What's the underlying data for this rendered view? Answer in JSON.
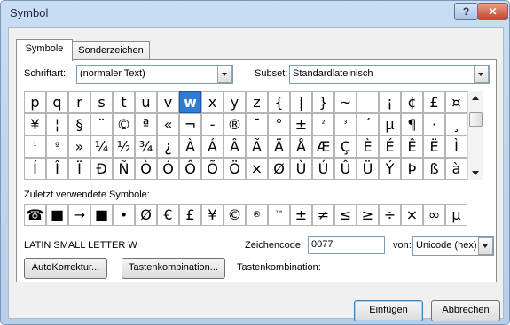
{
  "window": {
    "title": "Symbol"
  },
  "tabs": [
    "Symbole",
    "Sonderzeichen"
  ],
  "font": {
    "label": "Schriftart:",
    "value": "(normaler Text)"
  },
  "subset": {
    "label": "Subset:",
    "value": "Standardlateinisch"
  },
  "symbols": [
    [
      "p",
      "q",
      "r",
      "s",
      "t",
      "u",
      "v",
      "w",
      "x",
      "y",
      "z",
      "{",
      "|",
      "}",
      "~",
      "",
      "¡",
      "¢",
      "£",
      "¤"
    ],
    [
      "¥",
      "¦",
      "§",
      "¨",
      "©",
      "ª",
      "«",
      "¬",
      "-",
      "®",
      "¯",
      "°",
      "±",
      "²",
      "³",
      "´",
      "µ",
      "¶",
      "·",
      "¸"
    ],
    [
      "¹",
      "º",
      "»",
      "¼",
      "½",
      "¾",
      "¿",
      "À",
      "Á",
      "Â",
      "Ã",
      "Ä",
      "Å",
      "Æ",
      "Ç",
      "È",
      "É",
      "Ê",
      "Ë",
      "Ì"
    ],
    [
      "Í",
      "Î",
      "Ï",
      "Ð",
      "Ñ",
      "Ò",
      "Ó",
      "Ô",
      "Õ",
      "Ö",
      "×",
      "Ø",
      "Ù",
      "Ú",
      "Û",
      "Ü",
      "Ý",
      "Þ",
      "ß",
      "à"
    ]
  ],
  "selected": {
    "row": 0,
    "col": 7
  },
  "recent": {
    "label": "Zuletzt verwendete Symbole:",
    "items": [
      "☎",
      "■",
      "→",
      "■",
      "•",
      "Ø",
      "€",
      "£",
      "¥",
      "©",
      "®",
      "™",
      "±",
      "≠",
      "≤",
      "≥",
      "÷",
      "×",
      "∞",
      "µ"
    ]
  },
  "char_name": "LATIN SMALL LETTER W",
  "charcode": {
    "label": "Zeichencode:",
    "value": "0077"
  },
  "from": {
    "label": "von:",
    "value": "Unicode (hex)"
  },
  "buttons": {
    "autocorrect": "AutoKorrektur...",
    "shortcut": "Tastenkombination...",
    "insert": "Einfügen",
    "cancel": "Abbrechen"
  },
  "shortcut_label": "Tastenkombination:"
}
